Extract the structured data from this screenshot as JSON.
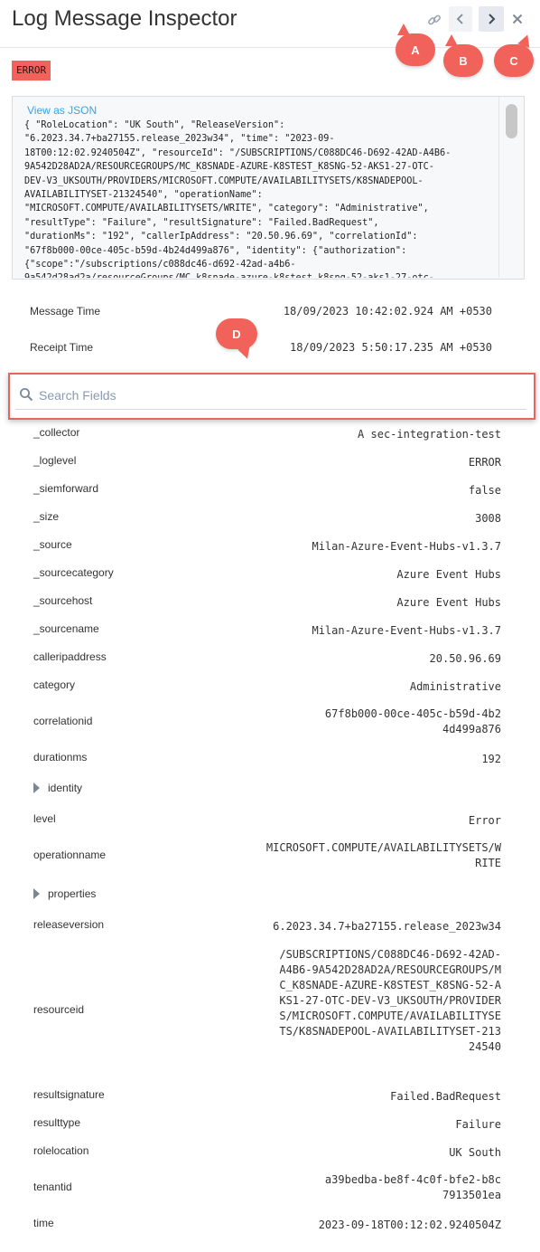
{
  "header": {
    "title": "Log Message Inspector",
    "icons": [
      "link-icon",
      "chevron-left-icon",
      "chevron-right-icon",
      "close-icon"
    ]
  },
  "markers": {
    "a": "A",
    "b": "B",
    "c": "C",
    "d": "D"
  },
  "level_badge": "ERROR",
  "json_panel": {
    "link_label": "View as JSON",
    "lines": [
      "{ \"RoleLocation\": \"UK South\", \"ReleaseVersion\":",
      "\"6.2023.34.7+ba27155.release_2023w34\", \"time\": \"2023-09-",
      "18T00:12:02.9240504Z\", \"resourceId\": \"/SUBSCRIPTIONS/C088DC46-D692-42AD-A4B6-",
      "9A542D28AD2A/RESOURCEGROUPS/MC_K8SNADE-AZURE-K8STEST_K8SNG-52-AKS1-27-OTC-",
      "DEV-V3_UKSOUTH/PROVIDERS/MICROSOFT.COMPUTE/AVAILABILITYSETS/K8SNADEPOOL-",
      "AVAILABILITYSET-21324540\", \"operationName\":",
      "\"MICROSOFT.COMPUTE/AVAILABILITYSETS/WRITE\", \"category\": \"Administrative\",",
      "\"resultType\": \"Failure\", \"resultSignature\": \"Failed.BadRequest\",",
      "\"durationMs\": \"192\", \"callerIpAddress\": \"20.50.96.69\", \"correlationId\":",
      "\"67f8b000-00ce-405c-b59d-4b24d499a876\", \"identity\": {\"authorization\":",
      "{\"scope\":\"/subscriptions/c088dc46-d692-42ad-a4b6-",
      "9a542d28ad2a/resourceGroups/MC_k8snade-azure-k8stest_k8sng-52-aks1-27-otc-"
    ]
  },
  "meta": {
    "message_time_label": "Message Time",
    "message_time": "18/09/2023 10:42:02.924 AM +0530",
    "receipt_time_label": "Receipt Time",
    "receipt_time": "18/09/2023 5:50:17.235 AM +0530"
  },
  "search": {
    "placeholder": "Search Fields",
    "value": ""
  },
  "fields": [
    {
      "name": "_collector",
      "value": "A sec-integration-test"
    },
    {
      "name": "_loglevel",
      "value": "ERROR"
    },
    {
      "name": "_siemforward",
      "value": "false"
    },
    {
      "name": "_size",
      "value": "3008"
    },
    {
      "name": "_source",
      "value": "Milan-Azure-Event-Hubs-v1.3.7"
    },
    {
      "name": "_sourcecategory",
      "value": "Azure Event Hubs"
    },
    {
      "name": "_sourcehost",
      "value": "Azure Event Hubs"
    },
    {
      "name": "_sourcename",
      "value": "Milan-Azure-Event-Hubs-v1.3.7"
    },
    {
      "name": "calleripaddress",
      "value": "20.50.96.69"
    },
    {
      "name": "category",
      "value": "Administrative"
    },
    {
      "name": "correlationid",
      "value": "67f8b000-00ce-405c-b59d-4b24d499a876"
    },
    {
      "name": "durationms",
      "value": "192"
    },
    {
      "name": "identity",
      "value": "",
      "expandable": true
    },
    {
      "name": "level",
      "value": "Error"
    },
    {
      "name": "operationname",
      "value": "MICROSOFT.COMPUTE/AVAILABILITYSETS/WRITE"
    },
    {
      "name": "properties",
      "value": "",
      "expandable": true
    },
    {
      "name": "releaseversion",
      "value": "6.2023.34.7+ba27155.release_2023w34"
    },
    {
      "name": "resourceid",
      "value": "/SUBSCRIPTIONS/C088DC46-D692-42AD-A4B6-9A542D28AD2A/RESOURCEGROUPS/MC_K8SNADE-AZURE-K8STEST_K8SNG-52-AKS1-27-OTC-DEV-V3_UKSOUTH/PROVIDERS/MICROSOFT.COMPUTE/AVAILABILITYSETS/K8SNADEPOOL-AVAILABILITYSET-21324540"
    },
    {
      "name": "resultsignature",
      "value": "Failed.BadRequest"
    },
    {
      "name": "resulttype",
      "value": "Failure"
    },
    {
      "name": "rolelocation",
      "value": "UK South"
    },
    {
      "name": "tenantid",
      "value": "a39bedba-be8f-4c0f-bfe2-b8c7913501ea"
    },
    {
      "name": "time",
      "value": "2023-09-18T00:12:02.9240504Z"
    }
  ],
  "colors": {
    "accent_red": "#f0625a",
    "link_blue": "#3aa3e0",
    "placeholder": "#8a9bb0"
  }
}
